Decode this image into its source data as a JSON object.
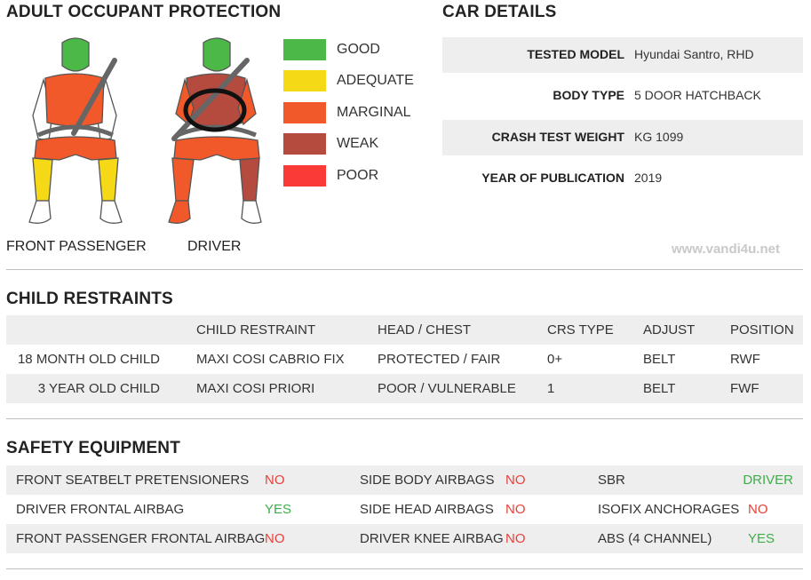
{
  "adult_occupant": {
    "title": "ADULT OCCUPANT PROTECTION",
    "front_passenger_label": "FRONT PASSENGER",
    "driver_label": "DRIVER"
  },
  "legend": [
    {
      "label": "GOOD",
      "color": "#4bb848"
    },
    {
      "label": "ADEQUATE",
      "color": "#f5d816"
    },
    {
      "label": "MARGINAL",
      "color": "#f1592a"
    },
    {
      "label": "WEAK",
      "color": "#b54a3f"
    },
    {
      "label": "POOR",
      "color": "#f93a36"
    }
  ],
  "car_details": {
    "title": "CAR DETAILS",
    "rows": [
      {
        "key": "TESTED MODEL",
        "value": "Hyundai Santro, RHD"
      },
      {
        "key": "BODY TYPE",
        "value": "5 DOOR HATCHBACK"
      },
      {
        "key": "CRASH TEST WEIGHT",
        "value": "KG 1099"
      },
      {
        "key": "YEAR OF PUBLICATION",
        "value": "2019"
      }
    ]
  },
  "watermark": "www.vandi4u.net",
  "child_restraints": {
    "title": "CHILD RESTRAINTS",
    "headers": [
      "CHILD RESTRAINT",
      "HEAD / CHEST",
      "CRS TYPE",
      "ADJUST",
      "POSITION"
    ],
    "rows": [
      {
        "label": "18 MONTH OLD CHILD",
        "restraint": "MAXI COSI CABRIO FIX",
        "head_chest": "PROTECTED / FAIR",
        "crs_type": "0+",
        "adjust": "BELT",
        "position": "RWF"
      },
      {
        "label": "3 YEAR OLD CHILD",
        "restraint": "MAXI COSI PRIORI",
        "head_chest": "POOR / VULNERABLE",
        "crs_type": "1",
        "adjust": "BELT",
        "position": "FWF"
      }
    ]
  },
  "safety_equipment": {
    "title": "SAFETY EQUIPMENT",
    "rows": [
      [
        {
          "name": "FRONT SEATBELT PRETENSIONERS",
          "value": "NO"
        },
        {
          "name": "SIDE BODY AIRBAGS",
          "value": "NO"
        },
        {
          "name": "SBR",
          "value": "DRIVER"
        }
      ],
      [
        {
          "name": "DRIVER FRONTAL AIRBAG",
          "value": "YES"
        },
        {
          "name": "SIDE HEAD AIRBAGS",
          "value": "NO"
        },
        {
          "name": "ISOFIX ANCHORAGES",
          "value": "NO"
        }
      ],
      [
        {
          "name": "FRONT PASSENGER FRONTAL AIRBAG",
          "value": "NO"
        },
        {
          "name": "DRIVER KNEE AIRBAG",
          "value": "NO"
        },
        {
          "name": "ABS (4 CHANNEL)",
          "value": "YES"
        }
      ]
    ]
  },
  "ratings": {
    "passenger": {
      "head": "GOOD",
      "chest": "MARGINAL",
      "arms": "MARGINAL",
      "thighs": "MARGINAL",
      "lower_legs": "ADEQUATE",
      "feet": "NONE"
    },
    "driver": {
      "head": "GOOD",
      "chest": "WEAK",
      "arms": "MARGINAL",
      "thighs": "MARGINAL",
      "lower_legs_left": "MARGINAL",
      "lower_legs_right": "WEAK",
      "feet_left": "MARGINAL",
      "feet_right": "NONE"
    }
  },
  "colors": {
    "no": "#e8413c",
    "yes": "#3fae49",
    "row_shade": "#eeeeee"
  }
}
